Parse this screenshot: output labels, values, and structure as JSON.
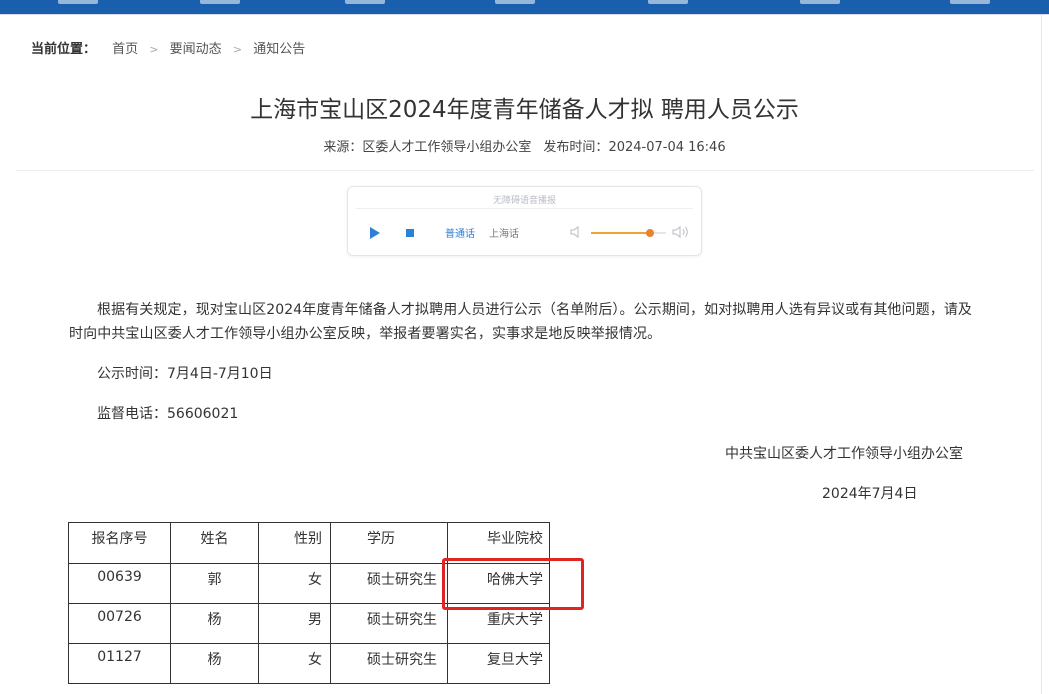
{
  "breadcrumb": {
    "label": "当前位置：",
    "items": [
      "首页",
      "要闻动态",
      "通知公告"
    ],
    "separator": ">"
  },
  "article": {
    "title": "上海市宝山区2024年度青年储备人才拟 聘用人员公示",
    "source_label": "来源：",
    "source": "区委人才工作领导小组办公室",
    "publish_label": "发布时间：",
    "publish_time": "2024-07-04 16:46"
  },
  "player": {
    "caption": "无障碍语音播报",
    "lang_mandarin": "普通话",
    "lang_shanghai": "上海话",
    "volume_level": 0.78,
    "accent_color": "#2f7fd6",
    "volume_color": "#f0a234",
    "icons": [
      "play-icon",
      "stop-icon",
      "volume-low-icon",
      "volume-high-icon"
    ]
  },
  "body": {
    "paragraph": "根据有关规定，现对宝山区2024年度青年储备人才拟聘用人员进行公示（名单附后）。公示期间，如对拟聘用人选有异议或有其他问题，请及时向中共宝山区委人才工作领导小组办公室反映，举报者要署实名，实事求是地反映举报情况。",
    "period": "公示时间：7月4日-7月10日",
    "phone": "监督电话：56606021",
    "signature": "中共宝山区委人才工作领导小组办公室",
    "date": "2024年7月4日"
  },
  "table": {
    "headers": [
      "报名序号",
      "姓名",
      "性别",
      "学历",
      "毕业院校"
    ],
    "rows": [
      [
        "00639",
        "郭",
        "女",
        "硕士研究生",
        "哈佛大学"
      ],
      [
        "00726",
        "杨",
        "男",
        "硕士研究生",
        "重庆大学"
      ],
      [
        "01127",
        "杨",
        "女",
        "硕士研究生",
        "复旦大学"
      ]
    ]
  },
  "annotation": {
    "highlight_color": "#e02424",
    "target": "哈佛大学"
  },
  "colors": {
    "nav_bar": "#1a5fae",
    "text": "#333333"
  }
}
